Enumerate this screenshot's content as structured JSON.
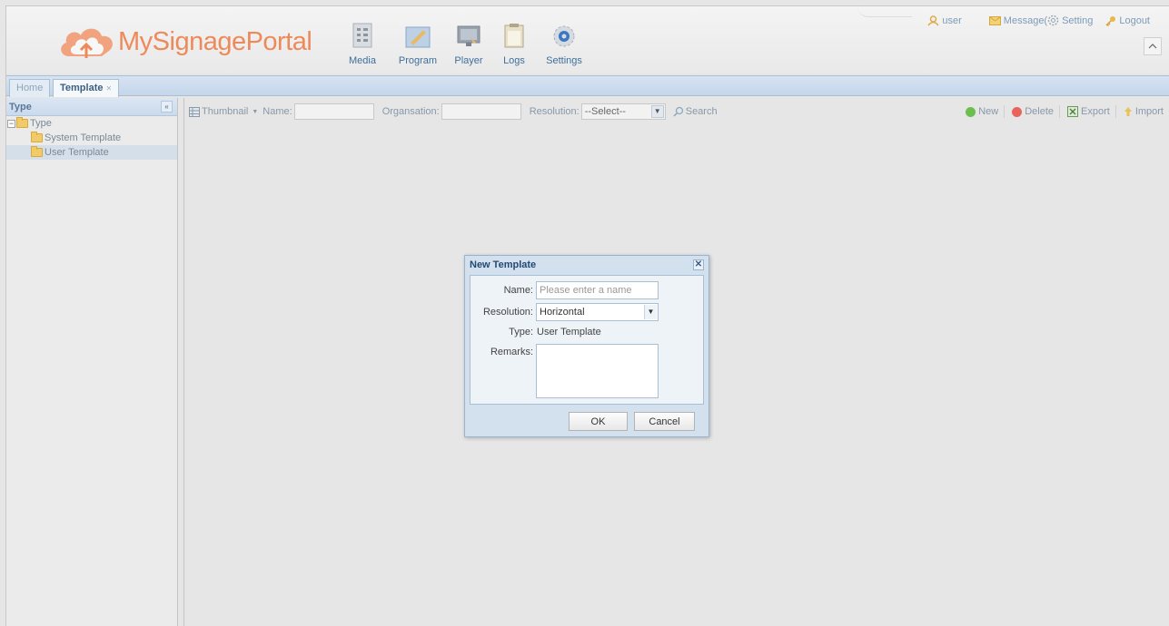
{
  "header": {
    "logo_text": "MySignagePortal",
    "nav": [
      {
        "label": "Media",
        "icon": "media-icon"
      },
      {
        "label": "Program",
        "icon": "program-icon"
      },
      {
        "label": "Player",
        "icon": "player-icon"
      },
      {
        "label": "Logs",
        "icon": "logs-icon"
      },
      {
        "label": "Settings",
        "icon": "settings-icon"
      }
    ],
    "top_links": {
      "user": "user",
      "message": "Message(",
      "setting": "Setting",
      "logout": "Logout"
    },
    "collapse_glyph": "^"
  },
  "tabs": [
    {
      "label": "Home",
      "active": false
    },
    {
      "label": "Template",
      "active": true
    }
  ],
  "left_panel": {
    "title": "Type",
    "tree": {
      "root": "Type",
      "children": [
        "System Template",
        "User Template"
      ]
    }
  },
  "toolbar": {
    "view": "Thumbnail",
    "name_label": "Name:",
    "org_label": "Organsation:",
    "resolution_label": "Resolution:",
    "resolution_value": "--Select--",
    "search": "Search",
    "new": "New",
    "delete": "Delete",
    "export": "Export",
    "import": "Import"
  },
  "dialog": {
    "title": "New Template",
    "name_label": "Name:",
    "name_placeholder": "Please enter a name",
    "resolution_label": "Resolution:",
    "resolution_value": "Horizontal",
    "type_label": "Type:",
    "type_value": "User Template",
    "remarks_label": "Remarks:",
    "ok": "OK",
    "cancel": "Cancel"
  },
  "colors": {
    "brand": "#ee8a5a",
    "nav_text": "#3f6f9b",
    "panel_header": "#cbdaec",
    "dialog_title": "#234a75"
  }
}
